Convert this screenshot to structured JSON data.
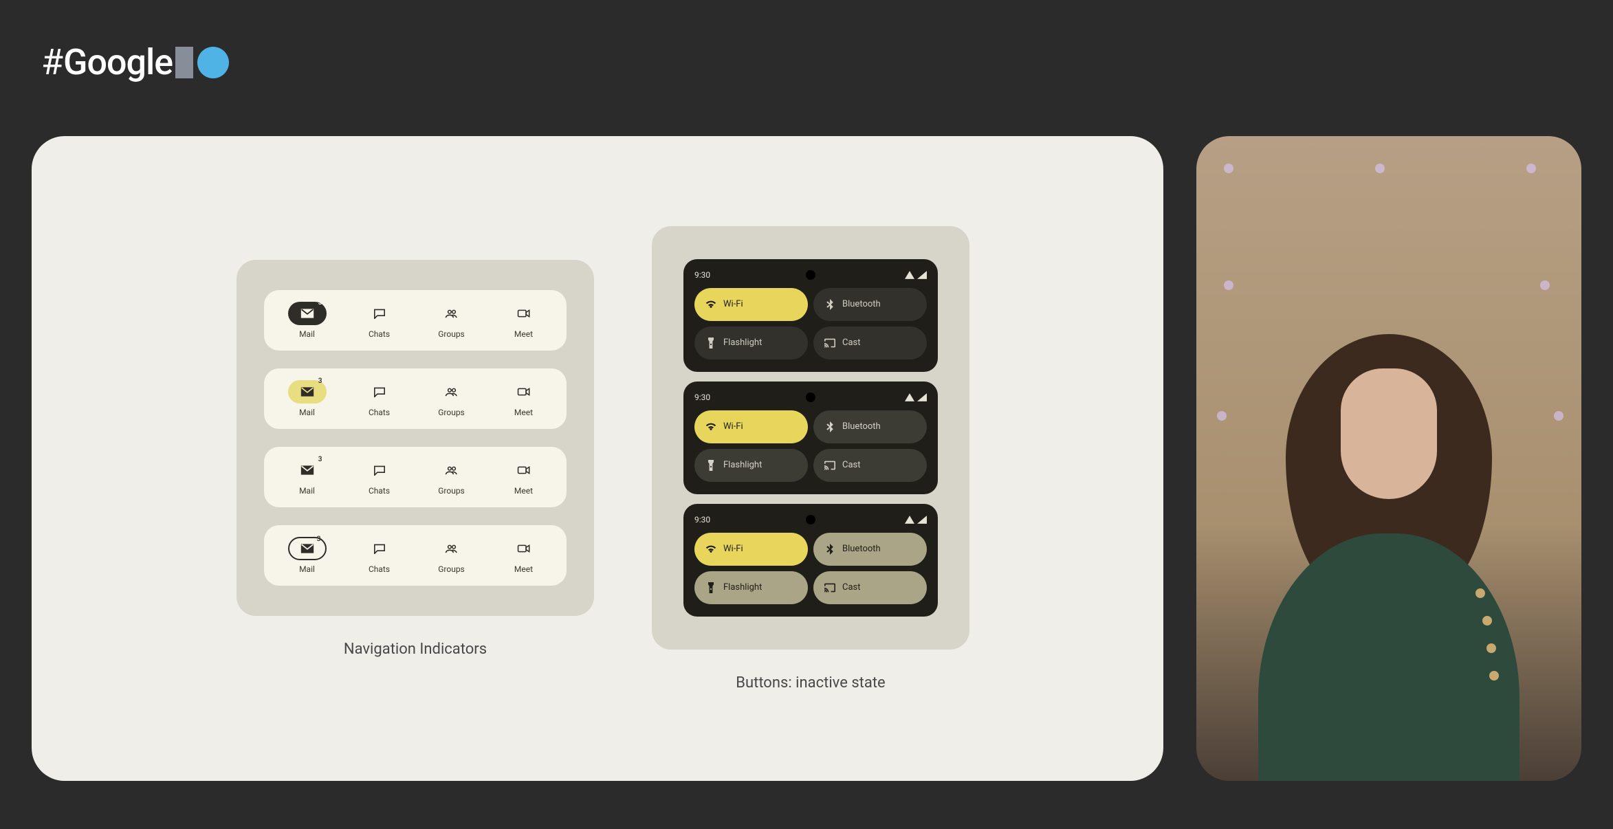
{
  "logo": {
    "hash": "#",
    "text": "Google"
  },
  "nav": {
    "badge": "3",
    "items": [
      "Mail",
      "Chats",
      "Groups",
      "Meet"
    ],
    "caption": "Navigation Indicators"
  },
  "qs": {
    "time": "9:30",
    "tiles": {
      "wifi": "Wi-Fi",
      "bluetooth": "Bluetooth",
      "flashlight": "Flashlight",
      "cast": "Cast"
    },
    "caption": "Buttons: inactive state"
  }
}
